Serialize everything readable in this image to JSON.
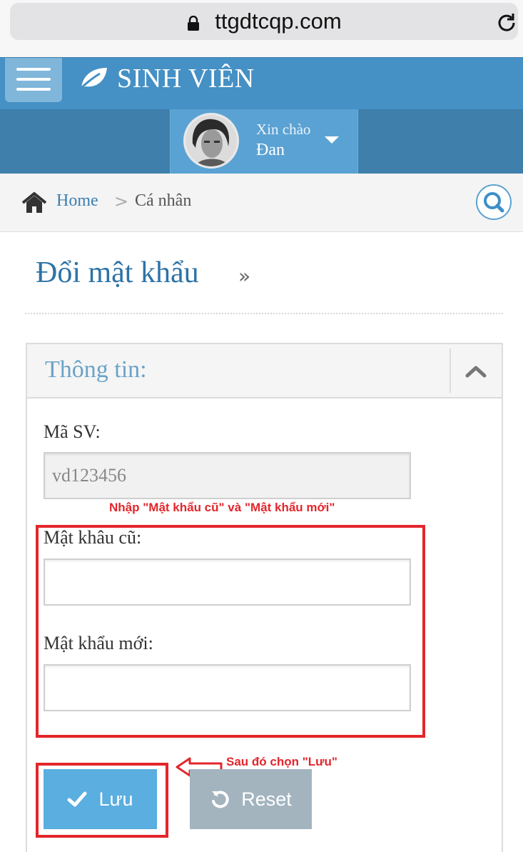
{
  "browser": {
    "url": "ttgdtcqp.com"
  },
  "header": {
    "brand_title": "SINH VIÊN"
  },
  "user": {
    "greeting": "Xin chào",
    "name": "Đan"
  },
  "breadcrumb": {
    "home_label": "Home",
    "separator": ">",
    "current": "Cá nhân"
  },
  "page": {
    "title": "Đổi mật khẩu",
    "title_suffix": "»"
  },
  "panel": {
    "title": "Thông tin:",
    "student_id_label": "Mã SV:",
    "student_id_value": "vd123456",
    "old_password_label": "Mật khâu cũ:",
    "new_password_label": "Mật khẩu mới:",
    "save_label": "Lưu",
    "reset_label": "Reset"
  },
  "annotations": {
    "enter_passwords": "Nhập \"Mật khẩu cũ\" và \"Mật khẩu mới\"",
    "then_save": "Sau đó chọn \"Lưu\""
  },
  "colors": {
    "header_blue": "#4590c4",
    "accent_blue": "#2d73a6",
    "save_button": "#5aaee0",
    "reset_button": "#a3b4bf",
    "annotation_red": "#e3262b"
  }
}
